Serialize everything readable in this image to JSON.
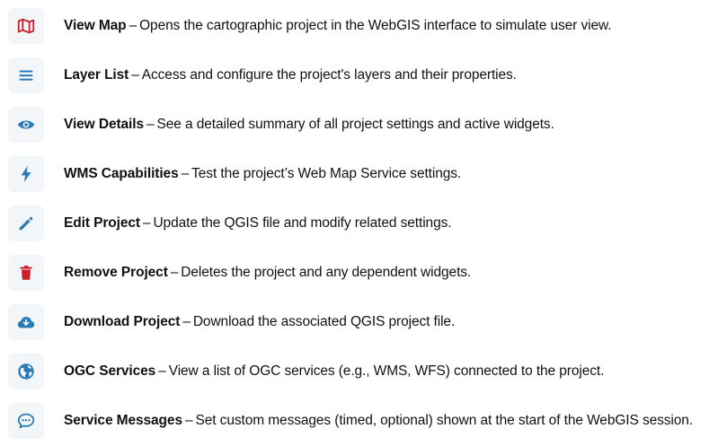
{
  "separator": "–",
  "colors": {
    "blue": "#2a7ab8",
    "red": "#c8202a",
    "icon_bg": "#f3f6f9"
  },
  "items": [
    {
      "icon": "map-icon",
      "title": "View Map",
      "desc": "Opens the cartographic project in the WebGIS interface to simulate user view."
    },
    {
      "icon": "list-icon",
      "title": "Layer List",
      "desc": "Access and configure the project's layers and their properties."
    },
    {
      "icon": "eye-icon",
      "title": "View Details",
      "desc": "See a detailed summary of all project settings and active widgets."
    },
    {
      "icon": "lightning-icon",
      "title": "WMS Capabilities",
      "desc": "Test the project’s Web Map Service settings."
    },
    {
      "icon": "pencil-icon",
      "title": "Edit Project",
      "desc": "Update the QGIS file and modify related settings."
    },
    {
      "icon": "trash-icon",
      "title": "Remove Project",
      "desc": "Deletes the project and any dependent widgets."
    },
    {
      "icon": "cloud-download-icon",
      "title": "Download Project",
      "desc": "Download the associated QGIS project file."
    },
    {
      "icon": "globe-icon",
      "title": "OGC Services",
      "desc": "View a list of OGC services (e.g., WMS, WFS) connected to the project."
    },
    {
      "icon": "chat-bubble-icon",
      "title": "Service Messages",
      "desc": "Set custom messages (timed, optional) shown at the start of the WebGIS session."
    }
  ]
}
